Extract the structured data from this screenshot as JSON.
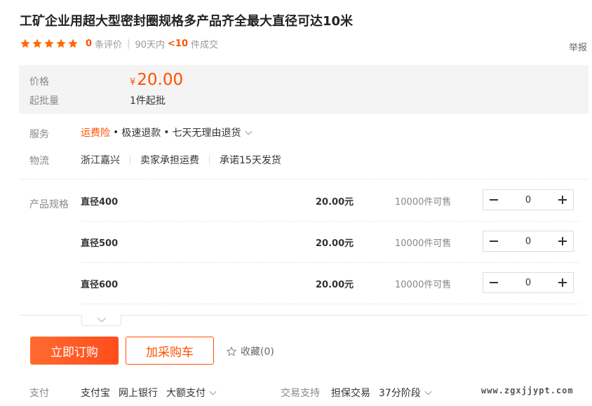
{
  "product": {
    "title": "工矿企业用超大型密封圈规格多产品齐全最大直径可达10米"
  },
  "rating": {
    "stars": 5,
    "review_count": "0",
    "review_label": "条评价",
    "period": "90天内",
    "deal_count": "<10",
    "deal_label": "件成交",
    "report": "举报"
  },
  "price": {
    "label": "价格",
    "currency": "¥",
    "value": "20.00",
    "moq_label": "起批量",
    "moq_value": "1件起批"
  },
  "service": {
    "label": "服务",
    "insurance": "运费险",
    "dot": "•",
    "items": [
      "极速退款",
      "七天无理由退货"
    ]
  },
  "logistics": {
    "label": "物流",
    "items": [
      "浙江嘉兴",
      "卖家承担运费",
      "承诺15天发货"
    ]
  },
  "sku": {
    "label": "产品规格",
    "rows": [
      {
        "name": "直径400",
        "price": "20.00元",
        "stock": "10000件可售",
        "qty": "0"
      },
      {
        "name": "直径500",
        "price": "20.00元",
        "stock": "10000件可售",
        "qty": "0"
      },
      {
        "name": "直径600",
        "price": "20.00元",
        "stock": "10000件可售",
        "qty": "0"
      }
    ]
  },
  "actions": {
    "buy": "立即订购",
    "cart": "加采购车",
    "favorite": "收藏(0)"
  },
  "payment": {
    "label": "支付",
    "items": [
      "支付宝",
      "网上银行",
      "大额支付"
    ]
  },
  "trade": {
    "label": "交易支持",
    "items": [
      "担保交易",
      "37分阶段"
    ]
  },
  "watermark": "www.zgxjjypt.com",
  "colors": {
    "accent": "#ff5000",
    "star": "#ff6a00",
    "price_bg": "#f4f4f4"
  }
}
